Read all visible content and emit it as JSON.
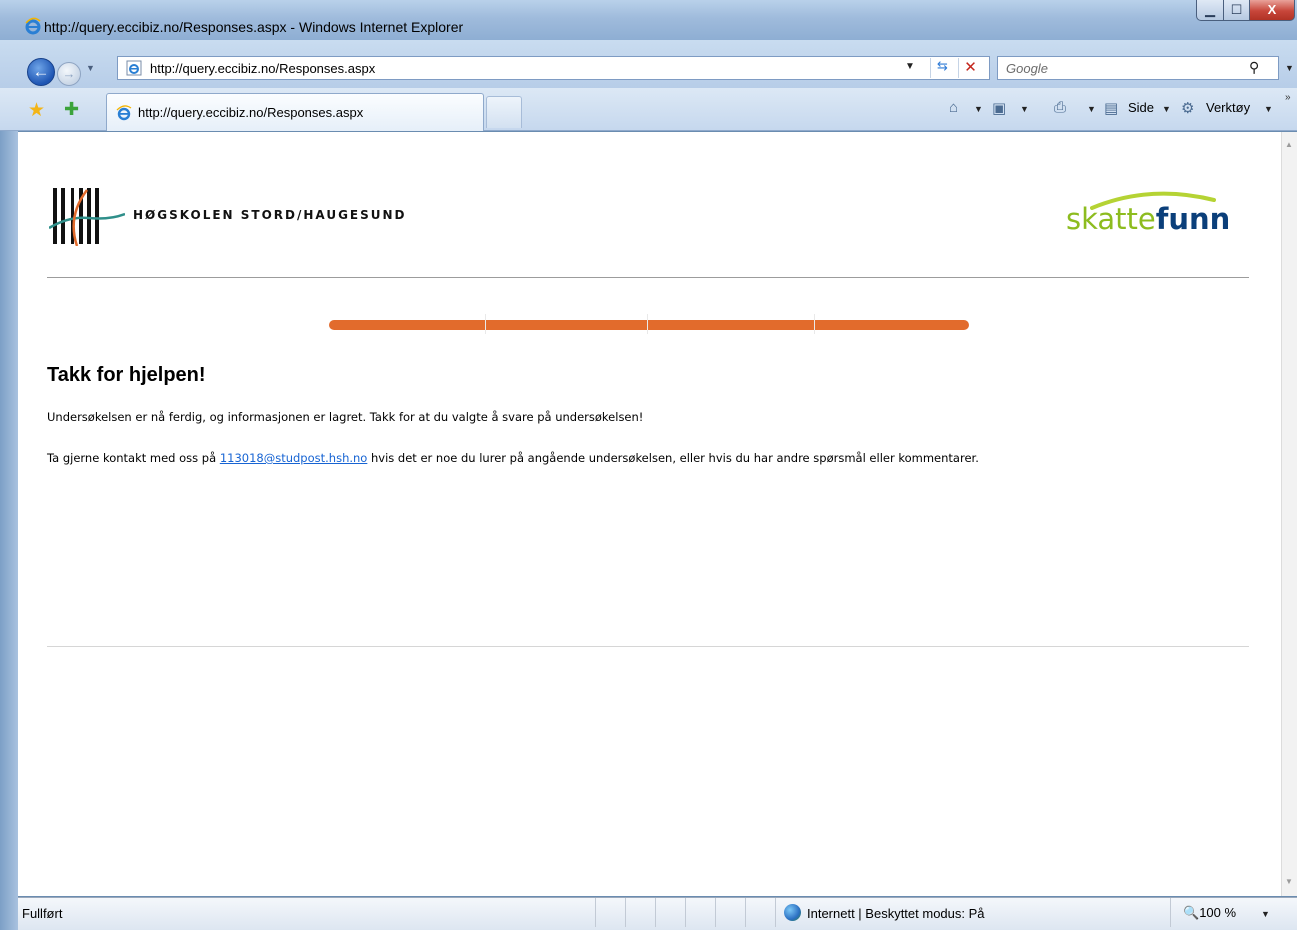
{
  "window": {
    "title": "http://query.eccibiz.no/Responses.aspx - Windows Internet Explorer",
    "min_glyph": "▁",
    "max_glyph": "☐",
    "close_glyph": "X"
  },
  "nav": {
    "back_glyph": "←",
    "forward_glyph": "→",
    "address": "http://query.eccibiz.no/Responses.aspx",
    "search_placeholder": "Google"
  },
  "tabs": [
    {
      "label": "http://query.eccibiz.no/Responses.aspx"
    }
  ],
  "commands": {
    "side": "Side",
    "verktoy": "Verktøy"
  },
  "page": {
    "school_name": "HØGSKOLEN STORD/HAUGESUND",
    "brand_part1": "skatte",
    "brand_part2": "funn",
    "heading": "Takk for hjelpen!",
    "paragraph1": "Undersøkelsen er nå ferdig, og informasjonen er lagret. Takk for at du valgte å svare på undersøkelsen!",
    "paragraph2_before": "Ta gjerne kontakt med oss på ",
    "contact_email": "113018@studpost.hsh.no",
    "paragraph2_after": " hvis det er noe du lurer på angående undersøkelsen, eller hvis du har andre spørsmål eller kommentarer.",
    "progress_fraction": 1.0
  },
  "status": {
    "text": "Fullført",
    "zone": "Internett | Beskyttet modus: På",
    "zoom": "100 %"
  },
  "colors": {
    "progress": "#e26b2c",
    "brand_green": "#8dbc1f",
    "brand_blue": "#0b3f7a",
    "link": "#1764d3"
  }
}
